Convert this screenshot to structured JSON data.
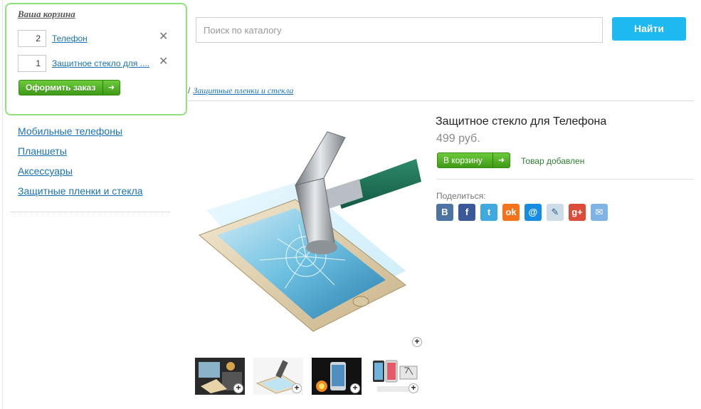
{
  "cart": {
    "title": "Ваша корзина",
    "items": [
      {
        "qty": "2",
        "name": "Телефон"
      },
      {
        "qty": "1",
        "name": "Защитное стекло для ...."
      }
    ],
    "remove_glyph": "✕",
    "checkout_label": "Оформить заказ"
  },
  "search": {
    "placeholder": "Поиск по каталогу",
    "button_label": "Найти"
  },
  "breadcrumb": {
    "separator": "/",
    "current": "Защитные пленки и стекла"
  },
  "categories": [
    "Мобильные телефоны",
    "Планшеты",
    "Аксессуары",
    "Защитные пленки и стекла"
  ],
  "product": {
    "title": "Защитное стекло для Телефона",
    "price": "499 руб.",
    "add_to_cart_label": "В корзину",
    "added_status": "Товар добавлен",
    "share_label": "Поделиться:"
  },
  "share_icons": [
    {
      "name": "vk-icon",
      "glyph": "B",
      "color": "#4c75a3"
    },
    {
      "name": "facebook-icon",
      "glyph": "f",
      "color": "#3b5998"
    },
    {
      "name": "twitter-icon",
      "glyph": "t",
      "color": "#3fa9e0"
    },
    {
      "name": "odnoklassniki-icon",
      "glyph": "ok",
      "color": "#f4731c"
    },
    {
      "name": "mailru-icon",
      "glyph": "@",
      "color": "#168de2"
    },
    {
      "name": "livejournal-icon",
      "glyph": "✎",
      "color": "#cfdce8"
    },
    {
      "name": "googleplus-icon",
      "glyph": "g+",
      "color": "#dd4b39"
    },
    {
      "name": "email-icon",
      "glyph": "✉",
      "color": "#7fb3e6"
    }
  ],
  "colors": {
    "accent_blue": "#1eb9f0",
    "link": "#1a73b8",
    "green_button": "#4aa521",
    "cart_border": "#8fe37a"
  }
}
